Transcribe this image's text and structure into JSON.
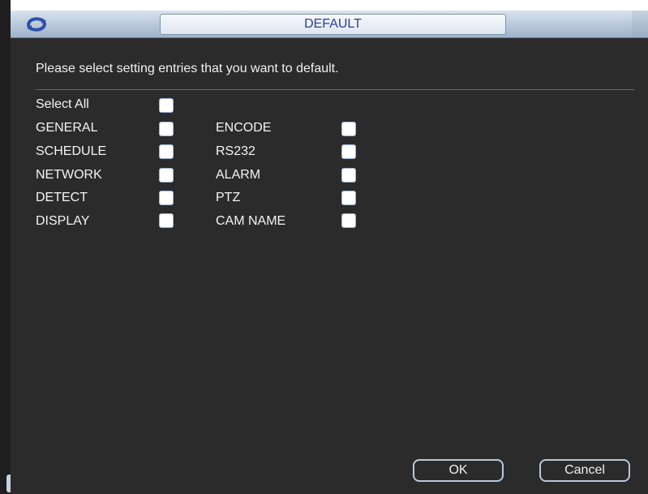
{
  "window": {
    "title": "DEFAULT",
    "logo_icon": "refresh-swirl-icon"
  },
  "instruction": "Please select setting entries that you want to default.",
  "select_all": {
    "label": "Select All",
    "checked": false
  },
  "entries_left": [
    {
      "label": "GENERAL",
      "checked": false
    },
    {
      "label": "SCHEDULE",
      "checked": false
    },
    {
      "label": "NETWORK",
      "checked": false
    },
    {
      "label": "DETECT",
      "checked": false
    },
    {
      "label": "DISPLAY",
      "checked": false
    }
  ],
  "entries_right": [
    {
      "label": "ENCODE",
      "checked": false
    },
    {
      "label": "RS232",
      "checked": false
    },
    {
      "label": "ALARM",
      "checked": false
    },
    {
      "label": "PTZ",
      "checked": false
    },
    {
      "label": "CAM NAME",
      "checked": false
    }
  ],
  "buttons": {
    "ok_label": "OK",
    "cancel_label": "Cancel"
  },
  "colors": {
    "background": "#2b2b2b",
    "title_text": "#2a3f9b",
    "checkbox_border": "#9db7d9"
  }
}
